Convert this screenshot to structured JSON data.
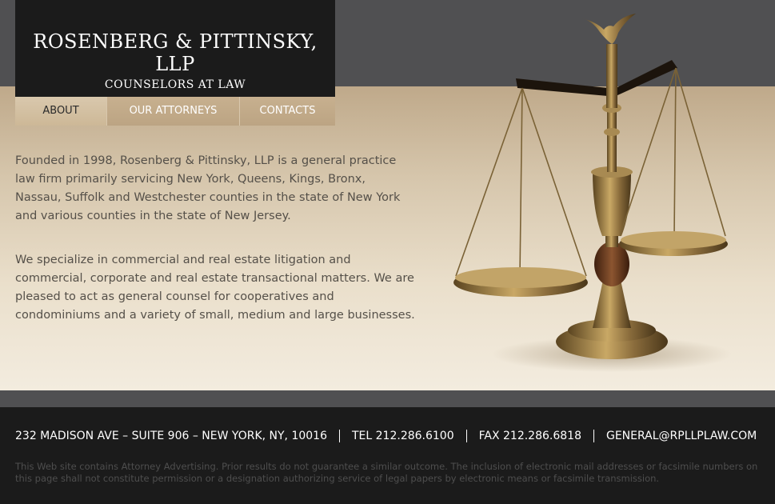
{
  "header": {
    "firm_name": "ROSENBERG & PITTINSKY, LLP",
    "subtitle": "COUNSELORS AT LAW"
  },
  "nav": {
    "items": [
      {
        "label": "ABOUT",
        "active": true
      },
      {
        "label": "OUR ATTORNEYS",
        "active": false
      },
      {
        "label": "CONTACTS",
        "active": false
      }
    ]
  },
  "main": {
    "paragraphs": [
      "Founded in 1998, Rosenberg & Pittinsky, LLP is a general practice law firm primarily servicing New York, Queens, Kings, Bronx, Nassau, Suffolk and Westchester counties in the state of New York and various counties in the state of New Jersey.",
      "We specialize in commercial and real estate litigation and commercial, corporate and real estate transactional matters. We are pleased to act as general counsel for cooperatives and condominiums and a variety of small, medium and large businesses."
    ],
    "image": {
      "icon": "scales-of-justice-icon"
    }
  },
  "footer": {
    "address": "232 MADISON AVE – SUITE 906 – NEW YORK, NY, 10016",
    "tel": "TEL 212.286.6100",
    "fax": "FAX 212.286.6818",
    "email": "GENERAL@RPLLPLAW.COM",
    "disclaimer": "This Web site contains Attorney Advertising. Prior results do not guarantee a similar outcome. The inclusion of electronic mail addresses or facsimile numbers on this page shall not constitute permission or a designation authorizing service of legal papers by electronic means or facsimile transmission."
  },
  "colors": {
    "dark": "#1b1b1b",
    "band": "#505052",
    "gold": "#8a6c3c",
    "nav_tan": "#c5ad8c"
  }
}
